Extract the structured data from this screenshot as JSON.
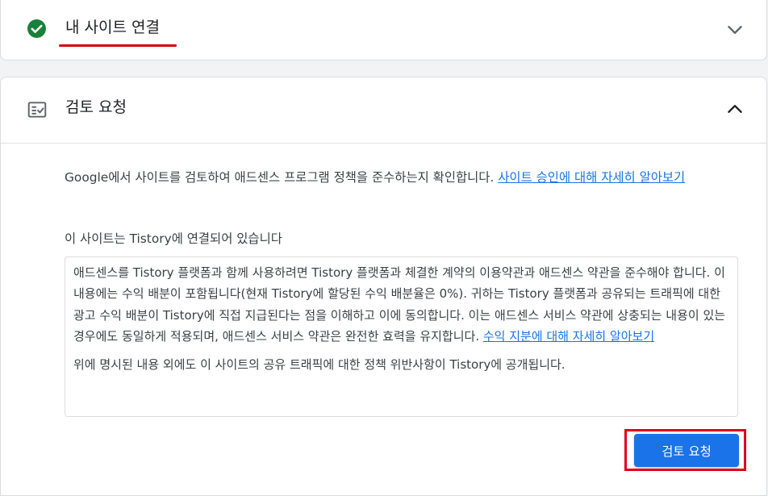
{
  "steps": {
    "connect": {
      "title": "내 사이트 연결",
      "status_icon": "check-circle-icon",
      "expand_icon": "chevron-down-icon"
    },
    "review": {
      "title": "검토 요청",
      "step_icon": "checklist-icon",
      "collapse_icon": "chevron-up-icon",
      "intro_text": "Google에서 사이트를 검토하여 애드센스 프로그램 정책을 준수하는지 확인합니다. ",
      "intro_link": "사이트 승인에 대해 자세히 알아보기",
      "connected_label": "이 사이트는 Tistory에 연결되어 있습니다",
      "terms_paragraph_1": "애드센스를 Tistory 플랫폼과 함께 사용하려면 Tistory 플랫폼과 체결한 계약의 이용약관과 애드센스 약관을 준수해야 합니다. 이 내용에는 수익 배분이 포함됩니다(현재 Tistory에 할당된 수익 배분율은 0%). 귀하는 Tistory 플랫폼과 공유되는 트래픽에 대한 광고 수익 배분이 Tistory에 직접 지급된다는 점을 이해하고 이에 동의합니다. 이는 애드센스 서비스 약관에 상충되는 내용이 있는 경우에도 동일하게 적용되며, 애드센스 서비스 약관은 완전한 효력을 유지합니다. ",
      "terms_link": "수익 지분에 대해 자세히 알아보기",
      "terms_paragraph_2": "위에 명시된 내용 외에도 이 사이트의 공유 트래픽에 대한 정책 위반사항이 Tistory에 공개됩니다.",
      "submit_label": "검토 요청"
    }
  },
  "colors": {
    "accent": "#1a73e8",
    "success": "#188038",
    "annotation_red": "#e0001b"
  }
}
